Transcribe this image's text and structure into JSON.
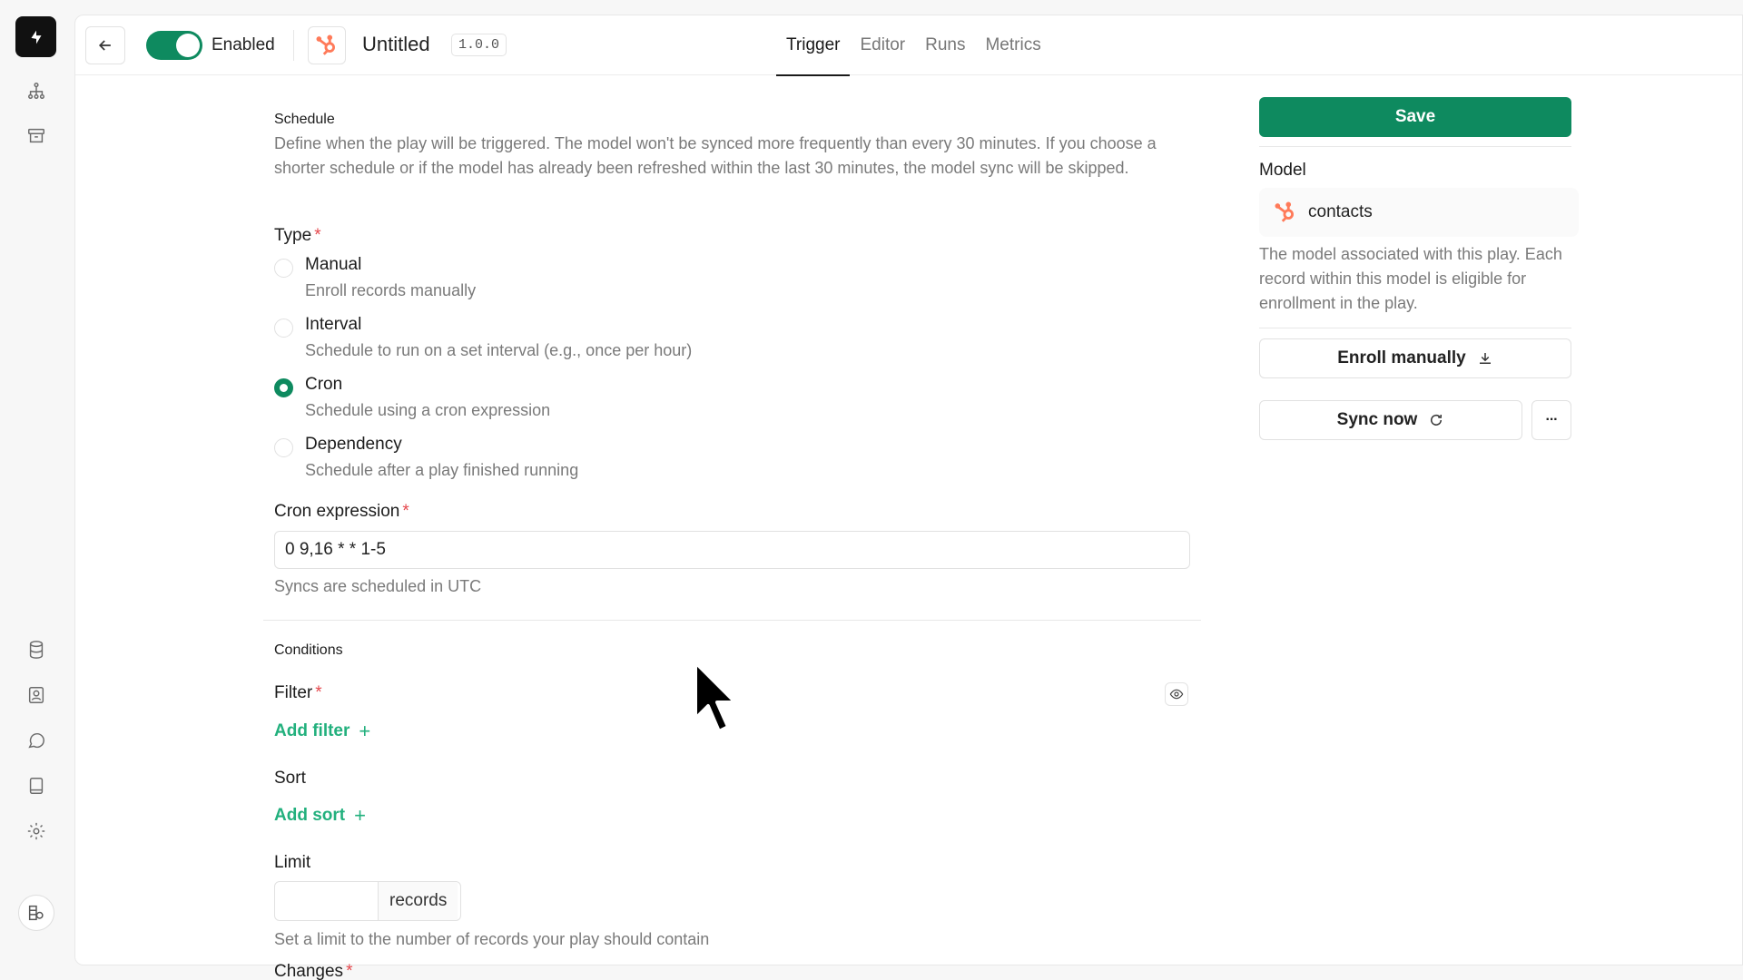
{
  "header": {
    "enabled_label": "Enabled",
    "title": "Untitled",
    "version": "1.0.0",
    "tabs": [
      "Trigger",
      "Editor",
      "Runs",
      "Metrics"
    ],
    "active_tab": "Trigger"
  },
  "schedule": {
    "section_title": "Schedule",
    "description": "Define when the play will be triggered. The model won't be synced more frequently than every 30 minutes. If you choose a shorter schedule or if the model has already been refreshed within the last 30 minutes, the model sync will be skipped.",
    "type_label": "Type",
    "options": [
      {
        "title": "Manual",
        "desc": "Enroll records manually",
        "checked": false
      },
      {
        "title": "Interval",
        "desc": "Schedule to run on a set interval (e.g., once per hour)",
        "checked": false
      },
      {
        "title": "Cron",
        "desc": "Schedule using a cron expression",
        "checked": true
      },
      {
        "title": "Dependency",
        "desc": "Schedule after a play finished running",
        "checked": false
      }
    ],
    "cron_label": "Cron expression",
    "cron_value": "0 9,16 * * 1-5",
    "cron_help": "Syncs are scheduled in UTC"
  },
  "conditions": {
    "section_title": "Conditions",
    "filter_label": "Filter",
    "add_filter": "Add filter",
    "sort_label": "Sort",
    "add_sort": "Add sort",
    "limit_label": "Limit",
    "limit_value": "",
    "limit_suffix": "records",
    "limit_help": "Set a limit to the number of records your play should contain",
    "changes_label": "Changes"
  },
  "sidebar": {
    "save_label": "Save",
    "model_label": "Model",
    "model_name": "contacts",
    "model_help": "The model associated with this play. Each record within this model is eligible for enrollment in the play.",
    "enroll_label": "Enroll manually",
    "sync_label": "Sync now",
    "more_label": "···"
  },
  "colors": {
    "accent": "#0e8a5f",
    "link": "#22b07d",
    "hubspot": "#ff7a59",
    "required": "#e5484d"
  }
}
